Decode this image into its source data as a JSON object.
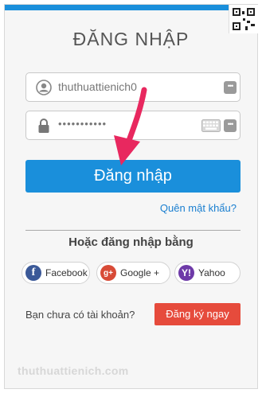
{
  "form": {
    "title": "ĐĂNG NHẬP",
    "username": {
      "value": "thuthuattienich0",
      "icon": "user-icon"
    },
    "password": {
      "masked_value": "•••••••••••",
      "icon": "lock-icon"
    },
    "login_label": "Đăng nhập",
    "forgot_label": "Quên mật khẩu?",
    "or_label": "Hoặc đăng nhập bằng"
  },
  "social": [
    {
      "label": "Facebook",
      "glyph": "f",
      "icon": "facebook-icon",
      "color": "#3b5998"
    },
    {
      "label": "Google +",
      "glyph": "g+",
      "icon": "google-plus-icon",
      "color": "#d84b37"
    },
    {
      "label": "Yahoo",
      "glyph": "Y!",
      "icon": "yahoo-icon",
      "color": "#6e3aa8"
    }
  ],
  "signup": {
    "prompt": "Bạn chưa có tài khoản?",
    "button_label": "Đăng ký ngay"
  },
  "watermark": "thuthuattienich.com",
  "colors": {
    "accent": "#1a8fdb",
    "signup": "#e64b3c",
    "arrow": "#e8285f"
  }
}
